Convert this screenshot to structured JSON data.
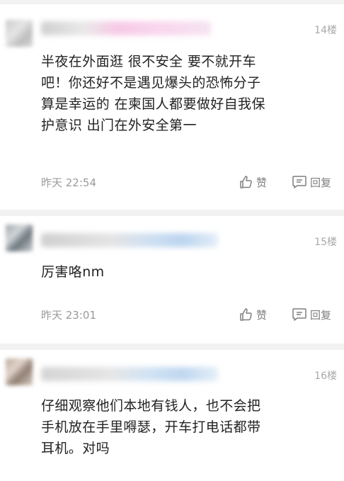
{
  "comments": [
    {
      "floor": "14楼",
      "lines": [
        "半夜在外面逛 很不安全 要不就开车",
        "吧！你还好不是遇见爆头的恐怖分子",
        "算是幸运的 在柬国人都要做好自我保",
        "护意识 出门在外安全第一"
      ],
      "time": "昨天 22:54",
      "like_label": "赞",
      "reply_label": "回复"
    },
    {
      "floor": "15楼",
      "lines": [
        "厉害咯nm"
      ],
      "time": "昨天 23:01",
      "like_label": "赞",
      "reply_label": "回复"
    },
    {
      "floor": "16楼",
      "lines": [
        "仔细观察他们本地有钱人，也不会把",
        "手机放在手里嘚瑟，开车打电话都带",
        "耳机。对吗"
      ]
    }
  ],
  "colors": {
    "divider": "#f2f2f2",
    "meta_text": "#9a9a9a",
    "floor_text": "#a8a8a8"
  }
}
